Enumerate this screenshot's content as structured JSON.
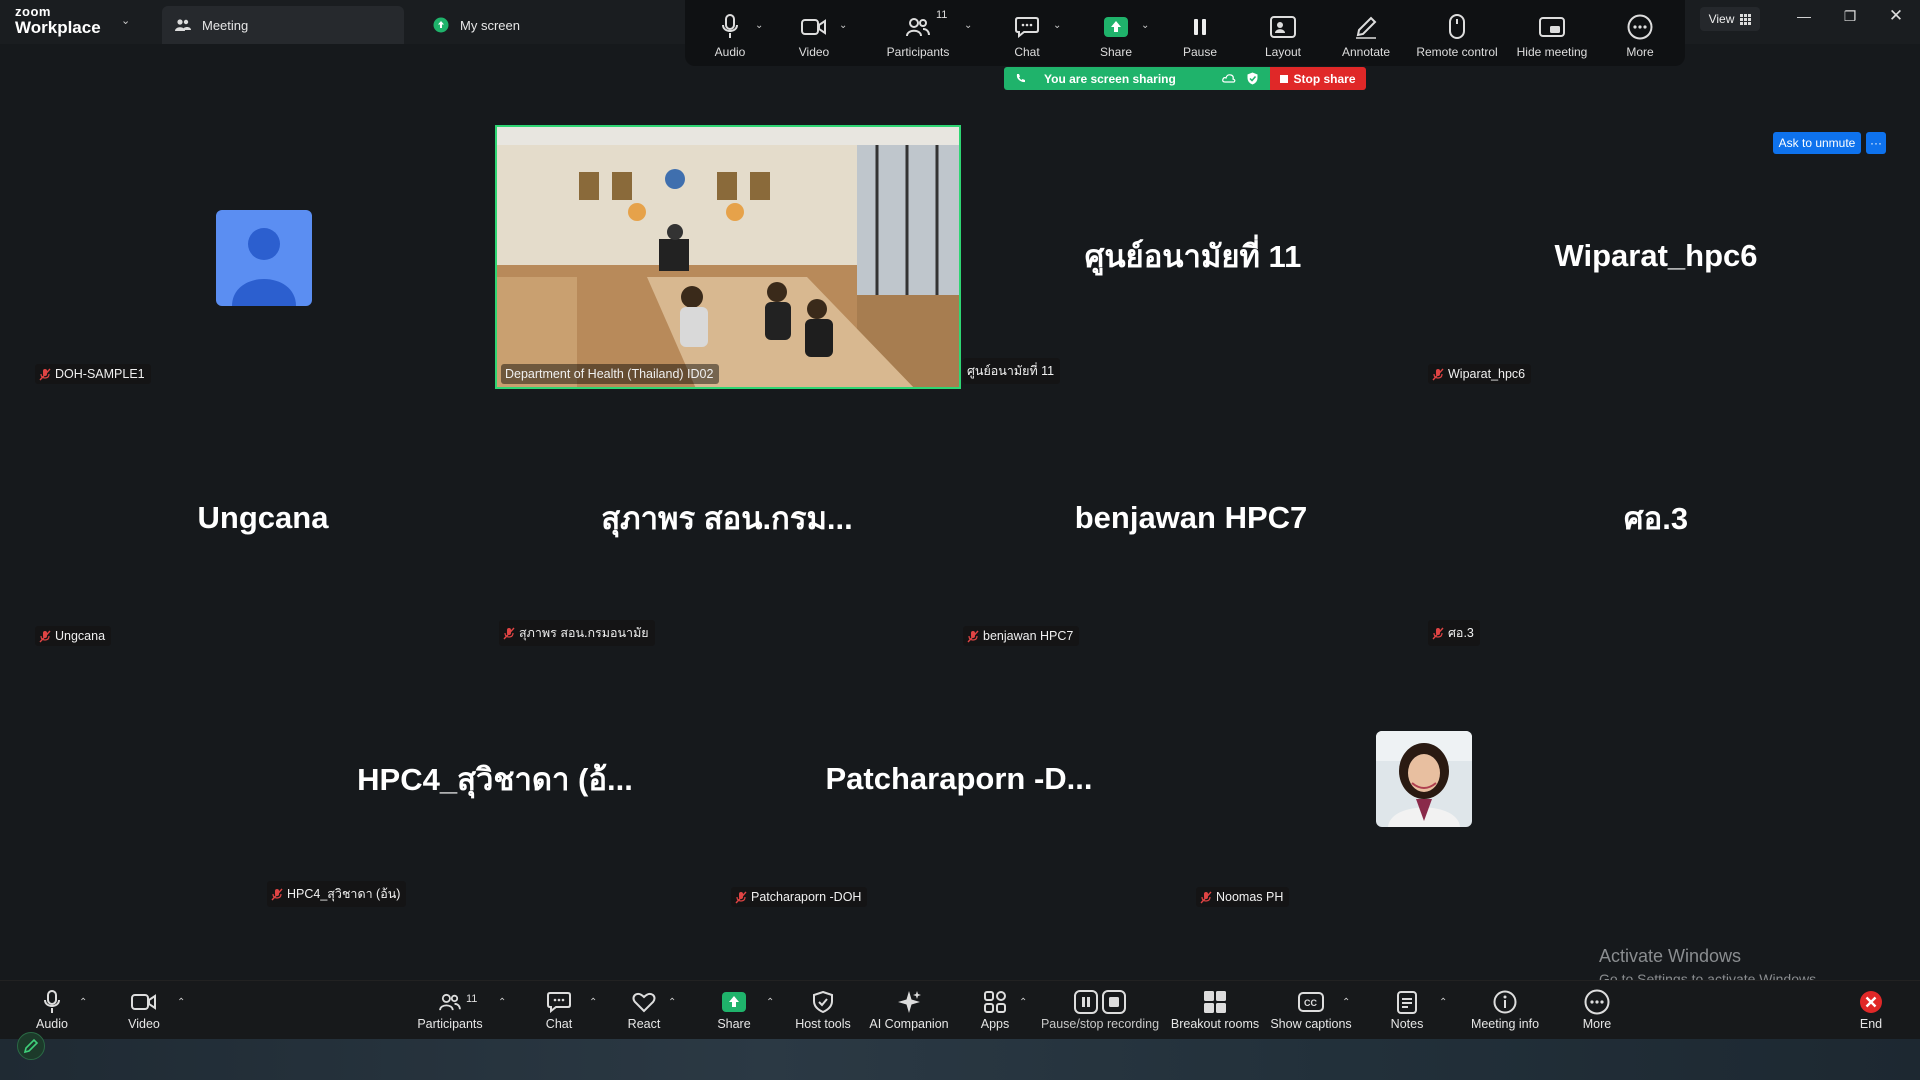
{
  "app": {
    "logo_line1": "zoom",
    "logo_line2": "Workplace",
    "tabs": [
      {
        "label": "Meeting",
        "active": true
      },
      {
        "label": "My screen",
        "active": false
      }
    ],
    "view_label": "View"
  },
  "top_toolbar": {
    "audio": "Audio",
    "video": "Video",
    "participants": "Participants",
    "participants_count": "11",
    "chat": "Chat",
    "share": "Share",
    "pause": "Pause",
    "layout": "Layout",
    "annotate": "Annotate",
    "remote_control": "Remote control",
    "hide_meeting": "Hide meeting",
    "more": "More"
  },
  "share_bar": {
    "status": "You are screen sharing",
    "stop_label": "Stop share"
  },
  "ask_to_unmute": "Ask to unmute",
  "more_dots": "···",
  "tiles": [
    {
      "big_name": "",
      "tag": "DOH-SAMPLE1",
      "kind": "avatar"
    },
    {
      "big_name": "",
      "tag": "Department of Health (Thailand) ID02",
      "kind": "video"
    },
    {
      "big_name": "ศูนย์อนามัยที่ 11",
      "tag": "ศูนย์อนามัยที่ 11",
      "kind": "name"
    },
    {
      "big_name": "Wiparat_hpc6",
      "tag": "Wiparat_hpc6",
      "kind": "name"
    },
    {
      "big_name": "Ungcana",
      "tag": "Ungcana",
      "kind": "name"
    },
    {
      "big_name": "สุภาพร สอน.กรม...",
      "tag": "สุภาพร สอน.กรมอนามัย",
      "kind": "name"
    },
    {
      "big_name": "benjawan HPC7",
      "tag": "benjawan HPC7",
      "kind": "name"
    },
    {
      "big_name": "ศอ.3",
      "tag": "ศอ.3",
      "kind": "name"
    },
    {
      "big_name": "HPC4_สุวิชาดา (อ้...",
      "tag": "HPC4_สุวิชาดา (อ้น)",
      "kind": "name"
    },
    {
      "big_name": "Patcharaporn  -D...",
      "tag": "Patcharaporn -DOH",
      "kind": "name"
    },
    {
      "big_name": "",
      "tag": "Noomas PH",
      "kind": "photo"
    }
  ],
  "watermark": {
    "line1": "Activate Windows",
    "line2": "Go to Settings to activate Windows."
  },
  "bottom_toolbar": {
    "audio": "Audio",
    "video": "Video",
    "participants": "Participants",
    "participants_count": "11",
    "chat": "Chat",
    "react": "React",
    "share": "Share",
    "host_tools": "Host tools",
    "ai_companion": "AI Companion",
    "apps": "Apps",
    "pause_stop_recording": "Pause/stop recording",
    "breakout_rooms": "Breakout rooms",
    "show_captions": "Show captions",
    "notes": "Notes",
    "meeting_info": "Meeting info",
    "more": "More",
    "end": "End"
  },
  "colors": {
    "accent_green": "#1fb36b",
    "stop_red": "#e02828",
    "blue": "#0e72ed",
    "active_speaker": "#2ed573"
  }
}
